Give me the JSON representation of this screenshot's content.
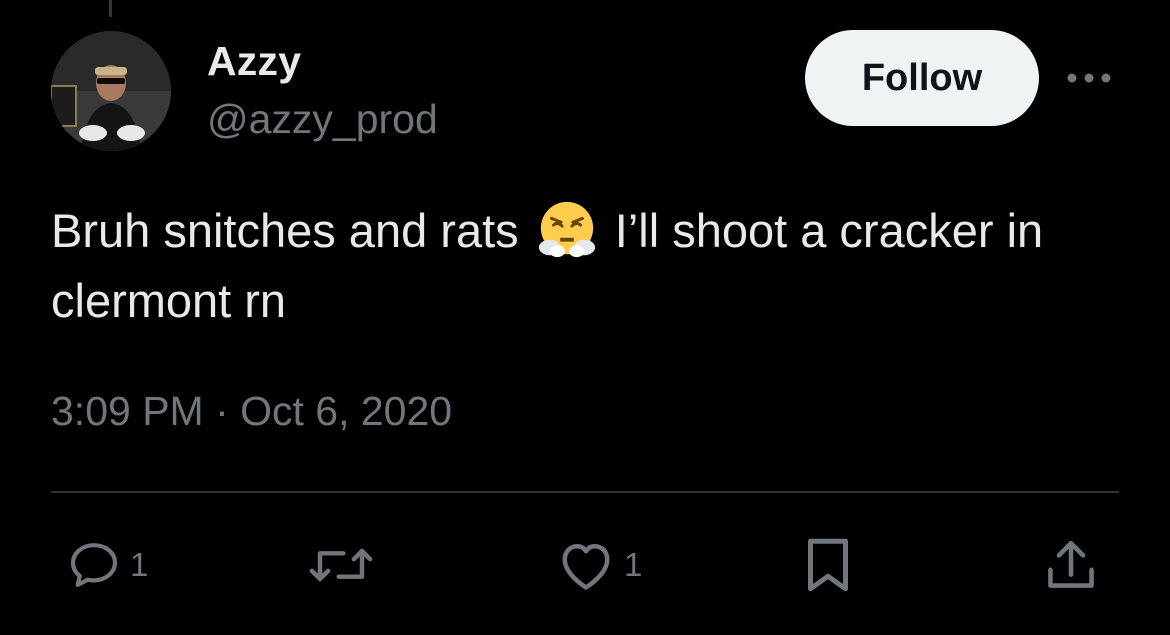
{
  "tweet": {
    "author": {
      "display_name": "Azzy",
      "handle": "@azzy_prod"
    },
    "follow_label": "Follow",
    "text_part1": "Bruh snitches and rats ",
    "emoji": "face-with-steam-from-nose",
    "text_part2": " I’ll shoot a cracker in clermont rn",
    "timestamp": "3:09 PM · Oct 6, 2020"
  },
  "actions": {
    "reply_count": "1",
    "like_count": "1"
  },
  "colors": {
    "background": "#000000",
    "primary_text": "#e7e9ea",
    "secondary_text": "#71767b",
    "follow_bg": "#eff3f4",
    "divider": "#2f3336"
  }
}
